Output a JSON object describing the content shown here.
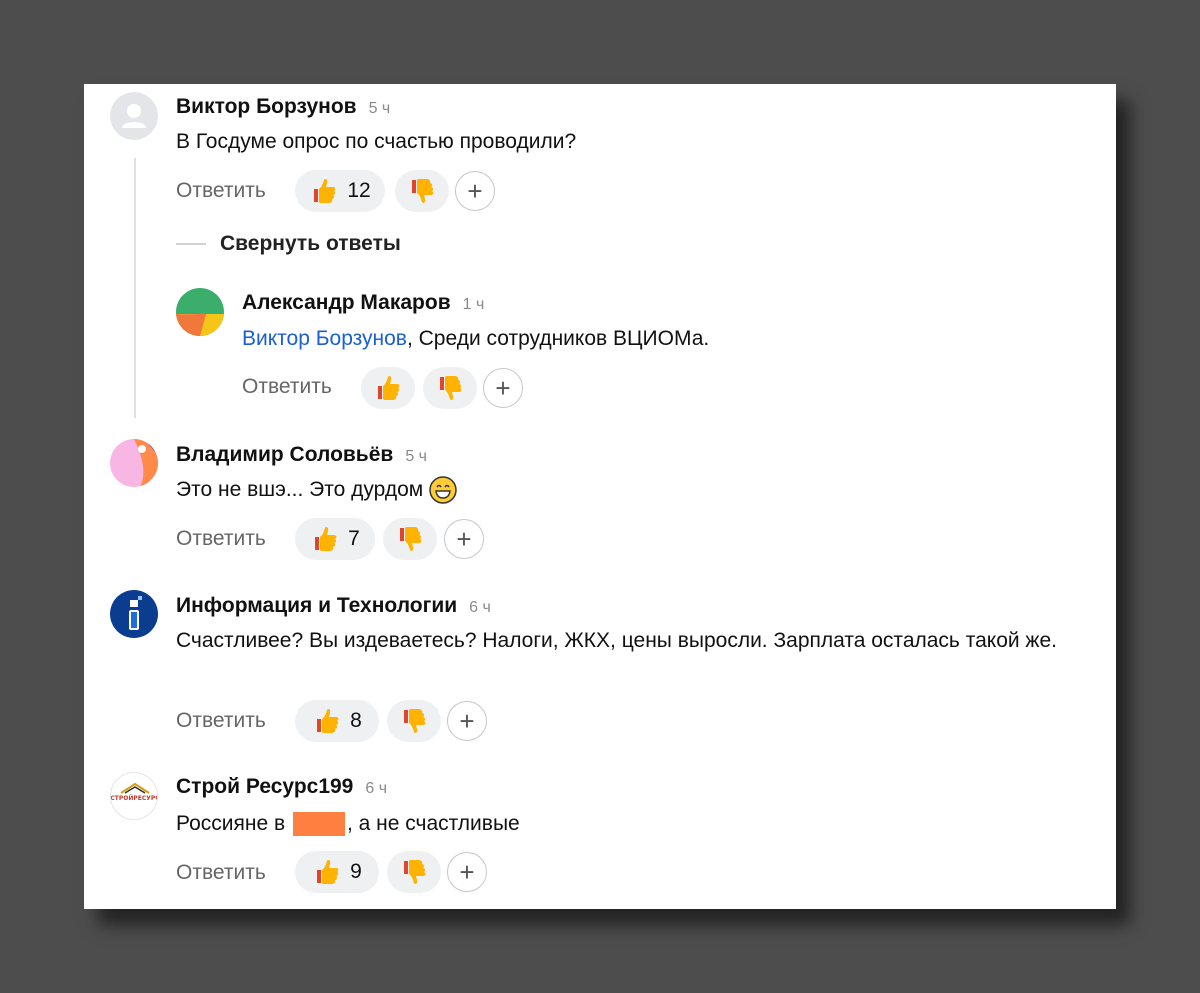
{
  "reply_label": "Ответить",
  "collapse_label": "Свернуть ответы",
  "comments": [
    {
      "author": "Виктор Борзунов",
      "time": "5 ч",
      "text": "В Госдуме опрос по счастью проводили?",
      "likes": "12"
    },
    {
      "author": "Александр Макаров",
      "time": "1 ч",
      "mention": "Виктор Борзунов",
      "text": ", Среди сотрудников ВЦИОМа.",
      "likes": ""
    },
    {
      "author": "Владимир Соловьёв",
      "time": "5 ч",
      "text": "Это не вшэ... Это дурдом",
      "likes": "7"
    },
    {
      "author": "Информация и Технологии",
      "time": "6 ч",
      "text": "Счастливее? Вы издеваетесь? Налоги, ЖКХ, цены выросли. Зарплата осталась такой же.",
      "likes": "8"
    },
    {
      "author": "Строй Ресурс199",
      "time": "6 ч",
      "text_before": "Россияне в ",
      "text_after": ", а не счастливые",
      "likes": "9",
      "avatar_logo": "СТРОЙРЕСУРС"
    }
  ],
  "plus_label": "+"
}
